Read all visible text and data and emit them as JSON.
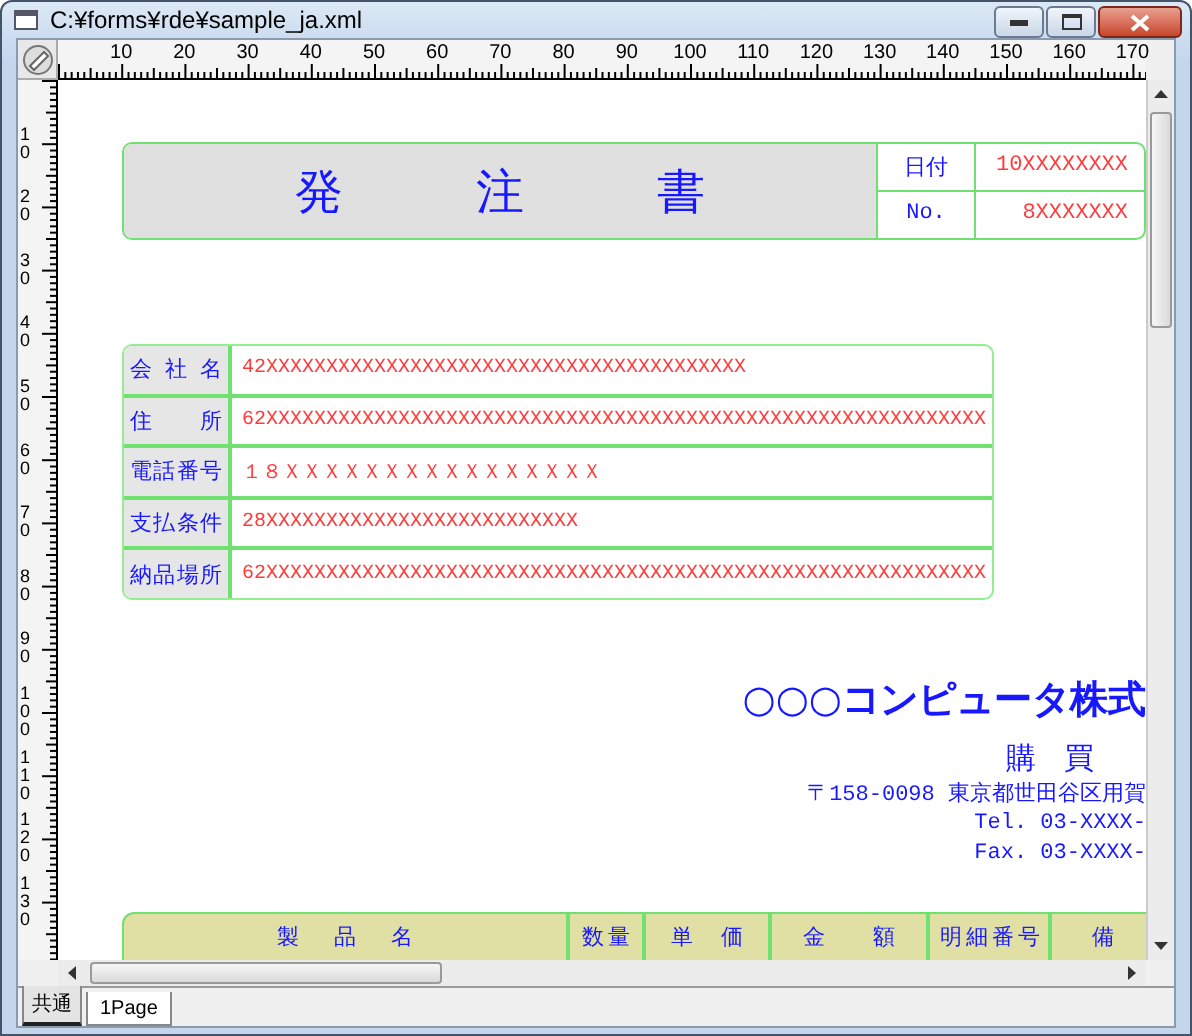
{
  "window": {
    "title": "C:¥forms¥rde¥sample_ja.xml"
  },
  "ruler": {
    "x_labels": [
      "10",
      "20",
      "30",
      "40",
      "50",
      "60",
      "70",
      "80",
      "90",
      "100",
      "110",
      "120",
      "130",
      "140",
      "150",
      "160",
      "170"
    ],
    "y_labels": [
      "10",
      "20",
      "30",
      "40",
      "50",
      "60",
      "70",
      "80",
      "90",
      "100",
      "110",
      "120",
      "130"
    ]
  },
  "header": {
    "title": "発注書",
    "fields": [
      {
        "label": "日付",
        "value": "10XXXXXXXX"
      },
      {
        "label": "No.",
        "value": "8XXXXXXX"
      }
    ]
  },
  "company_table": {
    "rows": [
      {
        "label": "会社名",
        "value": "42XXXXXXXXXXXXXXXXXXXXXXXXXXXXXXXXXXXXXXXX"
      },
      {
        "label": "住所",
        "value": "62XXXXXXXXXXXXXXXXXXXXXXXXXXXXXXXXXXXXXXXXXXXXXXXXXXXXXXXXXXXX"
      },
      {
        "label": "電話番号",
        "value": "１８ＸＸＸＸＸＸＸＸＸＸＸＸＸＸＸＸ"
      },
      {
        "label": "支払条件",
        "value": "28XXXXXXXXXXXXXXXXXXXXXXXXXX"
      },
      {
        "label": "納品場所",
        "value": "62XXXXXXXXXXXXXXXXXXXXXXXXXXXXXXXXXXXXXXXXXXXXXXXXXXXXXXXXXXXX"
      }
    ]
  },
  "issuer": {
    "company": "○○○コンピュータ株式",
    "department": "購買",
    "address": "〒158-0098 東京都世田谷区用賀",
    "tel": "Tel. 03-XXXX-",
    "fax": "Fax. 03-XXXX-"
  },
  "items_table": {
    "columns": [
      "製品名",
      "数量",
      "単価",
      "金額",
      "明細番号",
      "備"
    ]
  },
  "tabs": [
    {
      "label": "共通",
      "selected": false
    },
    {
      "label": "1Page",
      "selected": true
    }
  ]
}
